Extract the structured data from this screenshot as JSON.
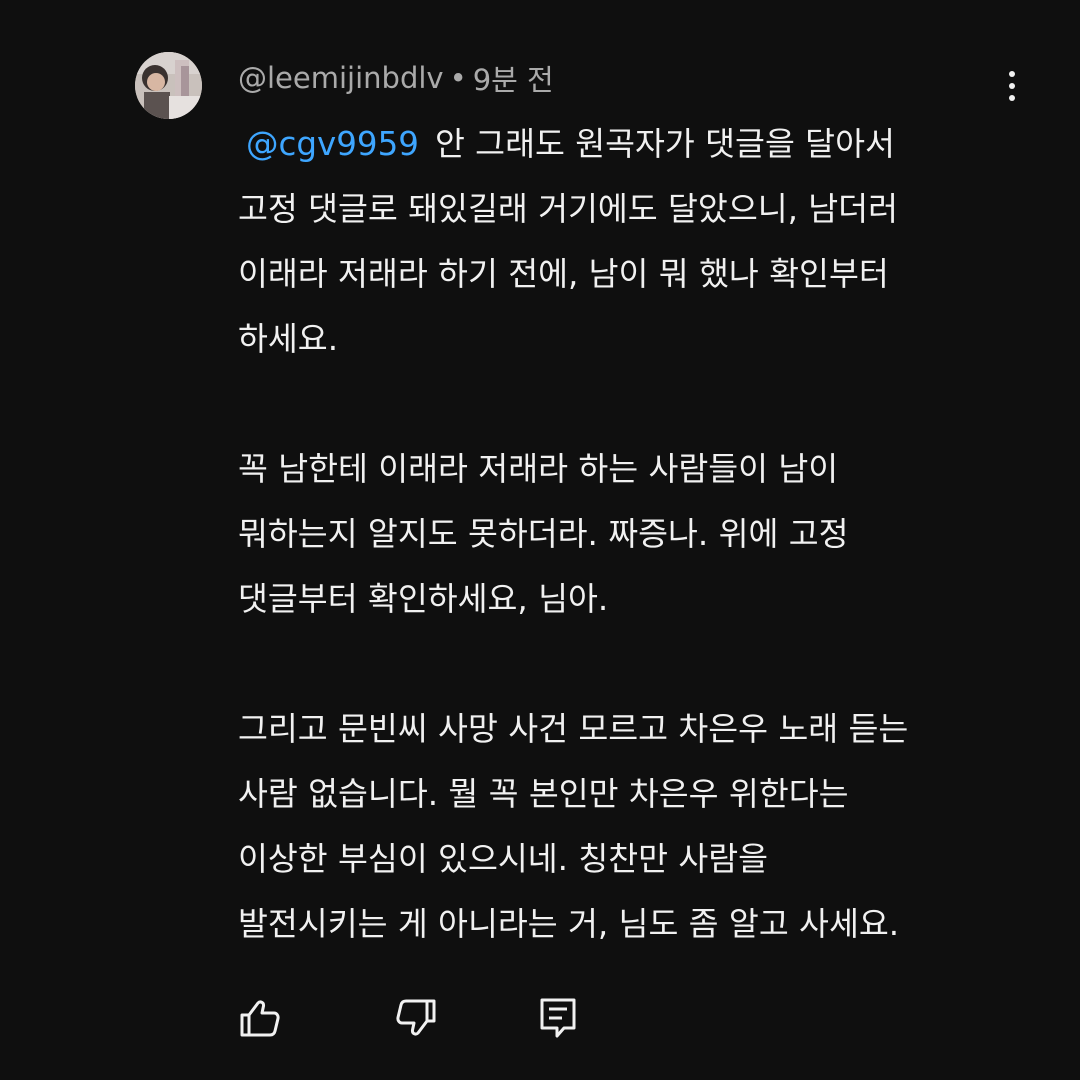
{
  "comment": {
    "author": "@leemijinbdlv",
    "separator": "•",
    "timestamp": "9분 전",
    "mention": "@cgv9959",
    "lines": [
      "안 그래도 원곡자가 댓글을 달아서",
      "고정 댓글로 돼있길래 거기에도 달았으니, 남더러",
      "이래라 저래라 하기 전에, 남이 뭐 했나 확인부터",
      "하세요.",
      "",
      "꼭 남한테 이래라 저래라 하는 사람들이 남이",
      "뭐하는지 알지도 못하더라. 짜증나. 위에 고정",
      "댓글부터 확인하세요, 님아.",
      "",
      "그리고 문빈씨 사망 사건 모르고 차은우 노래 듣는",
      "사람 없습니다. 뭘 꼭 본인만 차은우 위한다는",
      "이상한 부심이 있으시네. 칭찬만 사람을",
      "발전시키는 게 아니라는 거, 님도 좀 알고 사세요."
    ]
  },
  "icons": {
    "more": "more-vertical-icon",
    "like": "thumbs-up-icon",
    "dislike": "thumbs-down-icon",
    "reply": "reply-comment-icon"
  },
  "colors": {
    "background": "#0f0f0f",
    "text": "#f1f1f1",
    "secondary_text": "#aaaaaa",
    "mention": "#3ea6ff"
  }
}
